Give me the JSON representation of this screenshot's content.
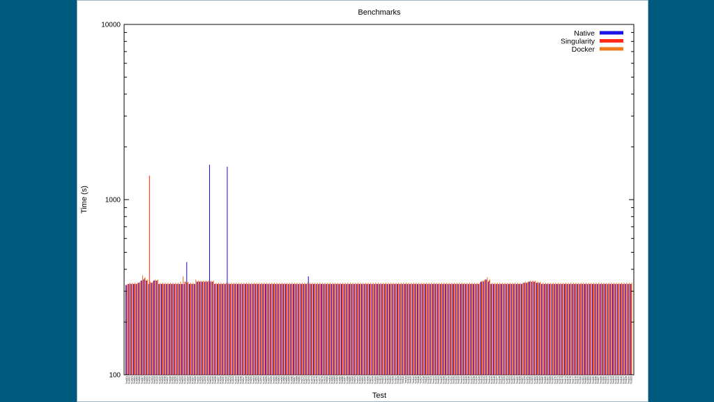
{
  "colors": {
    "background": "#005a80",
    "panel": "#ffffff",
    "native": "#1a14e6",
    "singularity": "#ff2a1a",
    "docker": "#f07a1e"
  },
  "chart_data": {
    "type": "bar",
    "title": "Benchmarks",
    "xlabel": "Test",
    "ylabel": "Time (s)",
    "yscale": "log",
    "ylim": [
      100,
      10000
    ],
    "yticks": [
      "100",
      "1000",
      "10000"
    ],
    "grid": false,
    "legend_position": "top-right",
    "categories": [
      "Test001",
      "Test002",
      "Test003",
      "Test004",
      "Test005",
      "Test006",
      "Test007",
      "Test008",
      "Test009",
      "Test010",
      "Test011",
      "Test012",
      "Test013",
      "Test014",
      "Test015",
      "Test016",
      "Test017",
      "Test018",
      "Test019",
      "Test020",
      "Test021",
      "Test022",
      "Test023",
      "Test024",
      "Test025",
      "Test026",
      "Test027",
      "Test028",
      "Test029",
      "Test030",
      "Test031",
      "Test032",
      "Test033",
      "Test034",
      "Test035",
      "Test036",
      "Test037",
      "Test038",
      "Test039",
      "Test040",
      "Test041",
      "Test042",
      "Test043",
      "Test044",
      "Test045",
      "Test046",
      "Test047",
      "Test048",
      "Test049",
      "Test050",
      "Test051",
      "Test052",
      "Test053",
      "Test054",
      "Test055",
      "Test056",
      "Test057",
      "Test058",
      "Test059",
      "Test060",
      "Test061",
      "Test062",
      "Test063",
      "Test064",
      "Test065",
      "Test066",
      "Test067",
      "Test068",
      "Test069",
      "Test070",
      "Test071",
      "Test072",
      "Test073",
      "Test074",
      "Test075",
      "Test076",
      "Test077",
      "Test078",
      "Test079",
      "Test080",
      "Test081",
      "Test082",
      "Test083",
      "Test084",
      "Test085",
      "Test086",
      "Test087",
      "Test088",
      "Test089",
      "Test090",
      "Test091",
      "Test092",
      "Test093",
      "Test094",
      "Test095",
      "Test096",
      "Test097",
      "Test098",
      "Test099",
      "Test100",
      "Test101",
      "Test102",
      "Test103",
      "Test104",
      "Test105",
      "Test106",
      "Test107",
      "Test108",
      "Test109",
      "Test110",
      "Test111",
      "Test112",
      "Test113",
      "Test114",
      "Test115",
      "Test116",
      "Test117",
      "Test118",
      "Test119",
      "Test120",
      "Test121",
      "Test122",
      "Test123",
      "Test124",
      "Test125",
      "Test126",
      "Test127",
      "Test128",
      "Test129",
      "Test130",
      "Test131",
      "Test132",
      "Test133",
      "Test134",
      "Test135",
      "Test136",
      "Test137",
      "Test138",
      "Test139",
      "Test140",
      "Test141",
      "Test142",
      "Test143",
      "Test144",
      "Test145",
      "Test146",
      "Test147",
      "Test148",
      "Test149",
      "Test150",
      "Test151",
      "Test152",
      "Test153",
      "Test154",
      "Test155",
      "Test156",
      "Test157",
      "Test158",
      "Test159",
      "Test160",
      "Test161",
      "Test162",
      "Test163",
      "Test164",
      "Test165",
      "Test166",
      "Test167",
      "Test168",
      "Test169",
      "Test170",
      "Test171",
      "Test172",
      "Test173",
      "Test174",
      "Test175",
      "Test176",
      "Test177",
      "Test178",
      "Test179",
      "Test180",
      "Test181",
      "Test182",
      "Test183",
      "Test184",
      "Test185",
      "Test186",
      "Test187",
      "Test188",
      "Test189",
      "Test190",
      "Test191",
      "Test192",
      "Test193",
      "Test194",
      "Test195",
      "Test196",
      "Test197",
      "Test198",
      "Test199",
      "Test200"
    ],
    "series": [
      {
        "name": "Native",
        "color": "#1a14e6",
        "values": [
          325,
          330,
          330,
          330,
          330,
          335,
          345,
          350,
          345,
          330,
          335,
          345,
          345,
          330,
          330,
          330,
          330,
          330,
          330,
          330,
          330,
          330,
          330,
          330,
          440,
          330,
          330,
          330,
          340,
          340,
          340,
          340,
          340,
          1580,
          340,
          330,
          330,
          330,
          330,
          330,
          1540,
          330,
          330,
          330,
          330,
          330,
          330,
          330,
          330,
          330,
          330,
          330,
          330,
          330,
          330,
          330,
          330,
          330,
          330,
          330,
          330,
          330,
          330,
          330,
          330,
          330,
          330,
          330,
          330,
          330,
          330,
          330,
          365,
          330,
          330,
          330,
          330,
          330,
          330,
          330,
          330,
          330,
          330,
          330,
          330,
          330,
          330,
          330,
          330,
          330,
          330,
          330,
          330,
          330,
          330,
          330,
          330,
          330,
          330,
          330,
          330,
          330,
          330,
          330,
          330,
          330,
          330,
          330,
          330,
          330,
          330,
          330,
          330,
          330,
          330,
          330,
          330,
          330,
          330,
          330,
          330,
          330,
          330,
          330,
          330,
          330,
          330,
          330,
          330,
          330,
          330,
          330,
          330,
          330,
          330,
          330,
          330,
          330,
          330,
          330,
          340,
          340,
          350,
          340,
          330,
          330,
          330,
          330,
          330,
          330,
          330,
          330,
          330,
          330,
          330,
          330,
          330,
          335,
          335,
          340,
          340,
          340,
          335,
          335,
          330,
          330,
          330,
          330,
          330,
          330,
          330,
          330,
          330,
          330,
          330,
          330,
          330,
          330,
          330,
          330,
          330,
          330,
          330,
          330,
          330,
          330,
          330,
          330,
          330,
          330,
          330,
          330,
          330,
          330,
          330,
          330,
          330,
          330,
          330,
          330
        ]
      },
      {
        "name": "Singularity",
        "color": "#ff2a1a",
        "values": [
          325,
          330,
          330,
          330,
          330,
          335,
          345,
          355,
          345,
          1370,
          335,
          345,
          345,
          330,
          330,
          330,
          330,
          330,
          330,
          330,
          330,
          330,
          330,
          340,
          335,
          330,
          330,
          330,
          340,
          340,
          340,
          340,
          340,
          340,
          340,
          330,
          330,
          330,
          330,
          330,
          330,
          330,
          330,
          330,
          330,
          330,
          330,
          330,
          330,
          330,
          330,
          330,
          330,
          330,
          330,
          330,
          330,
          330,
          330,
          330,
          330,
          330,
          330,
          330,
          330,
          330,
          330,
          330,
          330,
          330,
          330,
          330,
          330,
          330,
          330,
          330,
          330,
          330,
          330,
          330,
          330,
          330,
          330,
          330,
          330,
          330,
          330,
          330,
          330,
          330,
          330,
          330,
          330,
          330,
          330,
          330,
          330,
          330,
          330,
          330,
          330,
          330,
          330,
          330,
          330,
          330,
          330,
          330,
          330,
          330,
          330,
          330,
          330,
          330,
          330,
          330,
          330,
          330,
          330,
          330,
          330,
          330,
          330,
          330,
          330,
          330,
          330,
          330,
          330,
          330,
          330,
          330,
          330,
          330,
          330,
          330,
          330,
          330,
          330,
          330,
          340,
          345,
          350,
          345,
          330,
          330,
          330,
          330,
          330,
          330,
          330,
          330,
          330,
          330,
          330,
          330,
          330,
          335,
          335,
          340,
          340,
          340,
          335,
          335,
          330,
          330,
          330,
          330,
          330,
          330,
          330,
          330,
          330,
          330,
          330,
          330,
          330,
          330,
          330,
          330,
          330,
          330,
          330,
          330,
          330,
          330,
          330,
          330,
          330,
          330,
          330,
          330,
          330,
          330,
          330,
          330,
          330,
          330,
          330,
          330
        ]
      },
      {
        "name": "Docker",
        "color": "#f07a1e",
        "values": [
          330,
          335,
          335,
          335,
          335,
          340,
          370,
          360,
          350,
          340,
          340,
          350,
          350,
          335,
          335,
          335,
          335,
          335,
          335,
          335,
          335,
          340,
          365,
          340,
          340,
          335,
          335,
          350,
          345,
          345,
          345,
          345,
          345,
          345,
          345,
          335,
          335,
          335,
          335,
          335,
          335,
          335,
          335,
          335,
          335,
          335,
          335,
          335,
          335,
          335,
          335,
          335,
          335,
          335,
          335,
          335,
          335,
          335,
          335,
          335,
          335,
          335,
          335,
          335,
          335,
          335,
          335,
          335,
          335,
          335,
          335,
          335,
          335,
          335,
          335,
          335,
          335,
          335,
          335,
          335,
          335,
          335,
          335,
          335,
          335,
          335,
          335,
          335,
          335,
          335,
          335,
          335,
          335,
          335,
          335,
          335,
          335,
          335,
          335,
          335,
          335,
          335,
          335,
          335,
          335,
          335,
          335,
          335,
          335,
          335,
          335,
          335,
          335,
          335,
          335,
          335,
          335,
          335,
          335,
          335,
          335,
          335,
          335,
          335,
          335,
          335,
          335,
          335,
          335,
          335,
          335,
          335,
          335,
          335,
          335,
          335,
          335,
          335,
          335,
          335,
          345,
          350,
          360,
          350,
          335,
          335,
          335,
          335,
          335,
          335,
          335,
          335,
          335,
          335,
          335,
          335,
          335,
          340,
          340,
          345,
          345,
          345,
          340,
          340,
          335,
          335,
          335,
          335,
          335,
          335,
          335,
          335,
          335,
          335,
          335,
          335,
          335,
          335,
          335,
          335,
          335,
          335,
          335,
          335,
          335,
          335,
          335,
          335,
          335,
          335,
          335,
          335,
          335,
          335,
          335,
          335,
          335,
          335,
          335,
          335
        ]
      }
    ]
  }
}
